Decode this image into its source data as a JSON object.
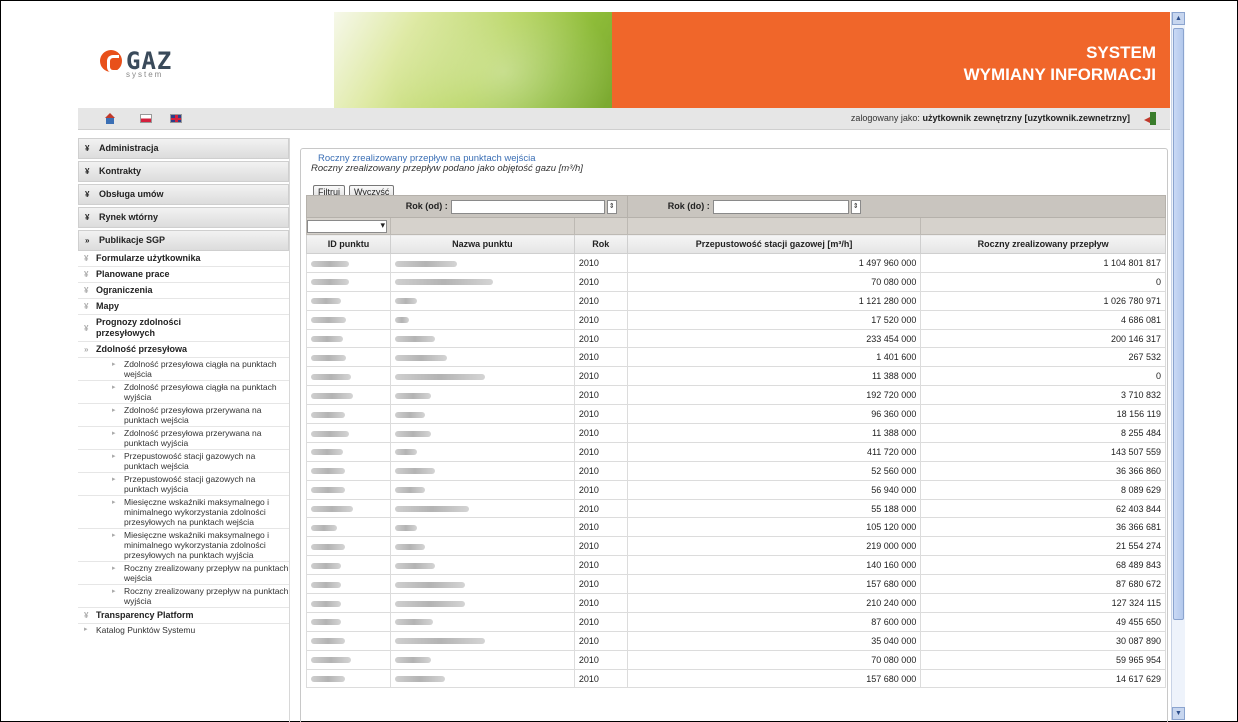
{
  "header": {
    "logo_text": "GAZ",
    "logo_sub": "system",
    "title_line1": "SYSTEM",
    "title_line2": "WYMIANY INFORMACJI"
  },
  "toolbar": {
    "login_prefix": "zalogowany jako:",
    "login_user": "użytkownik zewnętrzny [uzytkownik.zewnetrzny]"
  },
  "sidebar": {
    "sections": [
      {
        "label": "Administracja"
      },
      {
        "label": "Kontrakty"
      },
      {
        "label": "Obsługa umów"
      },
      {
        "label": "Rynek wtórny"
      },
      {
        "label": "Publikacje SGP"
      }
    ],
    "sub_items": [
      {
        "label": "Formularze użytkownika"
      },
      {
        "label": "Planowane prace"
      },
      {
        "label": "Ograniczenia"
      },
      {
        "label": "Mapy"
      },
      {
        "label": "Prognozy zdolności przesyłowych"
      },
      {
        "label": "Zdolność przesyłowa"
      }
    ],
    "leaf_items": [
      {
        "label": "Zdolność przesyłowa ciągła na punktach wejścia"
      },
      {
        "label": "Zdolność przesyłowa ciągła na punktach wyjścia"
      },
      {
        "label": "Zdolność przesyłowa przerywana na punktach wejścia"
      },
      {
        "label": "Zdolność przesyłowa przerywana na punktach wyjścia"
      },
      {
        "label": "Przepustowość stacji gazowych na punktach wejścia"
      },
      {
        "label": "Przepustowość stacji gazowych na punktach wyjścia"
      },
      {
        "label": "Miesięczne wskaźniki maksymalnego i minimalnego wykorzystania zdolności przesyłowych na punktach wejścia"
      },
      {
        "label": "Miesięczne wskaźniki maksymalnego i minimalnego wykorzystania zdolności przesyłowych na punktach wyjścia"
      },
      {
        "label": "Roczny zrealizowany przepływ na punktach wejścia"
      },
      {
        "label": "Roczny zrealizowany przepływ na punktach wyjścia"
      }
    ],
    "transparency": "Transparency Platform",
    "catalog": "Katalog Punktów Systemu"
  },
  "main": {
    "legend": "Roczny zrealizowany przepływ na punktach wejścia",
    "subtitle": "Roczny zrealizowany przepływ podano jako objętość gazu [m³/h]",
    "filter_button": "Filtruj",
    "clear_button": "Wyczyść",
    "year_from_label": "Rok (od) :",
    "year_to_label": "Rok (do) :",
    "columns": [
      "ID punktu",
      "Nazwa punktu",
      "Rok",
      "Przepustowość stacji gazowej [m³/h]",
      "Roczny zrealizowany przepływ"
    ],
    "rows": [
      {
        "rok": "2010",
        "przep": "1 497 960 000",
        "flow": "1 104 801 817"
      },
      {
        "rok": "2010",
        "przep": "70 080 000",
        "flow": "0"
      },
      {
        "rok": "2010",
        "przep": "1 121 280 000",
        "flow": "1 026 780 971"
      },
      {
        "rok": "2010",
        "przep": "17 520 000",
        "flow": "4 686 081"
      },
      {
        "rok": "2010",
        "przep": "233 454 000",
        "flow": "200 146 317"
      },
      {
        "rok": "2010",
        "przep": "1 401 600",
        "flow": "267 532"
      },
      {
        "rok": "2010",
        "przep": "11 388 000",
        "flow": "0"
      },
      {
        "rok": "2010",
        "przep": "192 720 000",
        "flow": "3 710 832"
      },
      {
        "rok": "2010",
        "przep": "96 360 000",
        "flow": "18 156 119"
      },
      {
        "rok": "2010",
        "przep": "11 388 000",
        "flow": "8 255 484"
      },
      {
        "rok": "2010",
        "przep": "411 720 000",
        "flow": "143 507 559"
      },
      {
        "rok": "2010",
        "przep": "52 560 000",
        "flow": "36 366 860"
      },
      {
        "rok": "2010",
        "przep": "56 940 000",
        "flow": "8 089 629"
      },
      {
        "rok": "2010",
        "przep": "55 188 000",
        "flow": "62 403 844"
      },
      {
        "rok": "2010",
        "przep": "105 120 000",
        "flow": "36 366 681"
      },
      {
        "rok": "2010",
        "przep": "219 000 000",
        "flow": "21 554 274"
      },
      {
        "rok": "2010",
        "przep": "140 160 000",
        "flow": "68 489 843"
      },
      {
        "rok": "2010",
        "przep": "157 680 000",
        "flow": "87 680 672"
      },
      {
        "rok": "2010",
        "przep": "210 240 000",
        "flow": "127 324 115"
      },
      {
        "rok": "2010",
        "przep": "87 600 000",
        "flow": "49 455 650"
      },
      {
        "rok": "2010",
        "przep": "35 040 000",
        "flow": "30 087 890"
      },
      {
        "rok": "2010",
        "przep": "70 080 000",
        "flow": "59 965 954"
      },
      {
        "rok": "2010",
        "przep": "157 680 000",
        "flow": "14 617 629"
      }
    ]
  },
  "icons": {
    "home": "home-icon",
    "flag_pl": "flag-pl-icon",
    "flag_en": "flag-en-icon",
    "logout": "logout-icon"
  },
  "colors": {
    "brand_orange": "#f0662a",
    "link_blue": "#3b6fb5"
  }
}
